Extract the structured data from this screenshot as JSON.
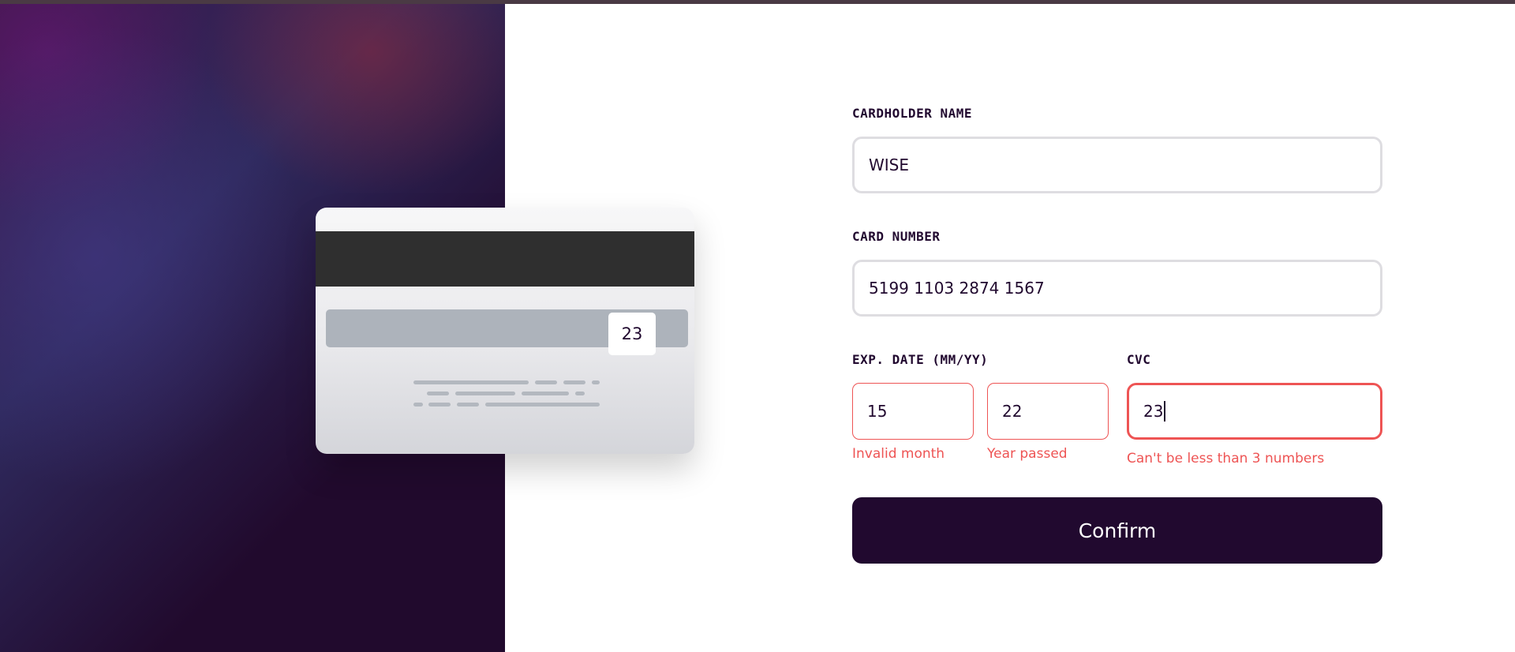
{
  "card_back": {
    "cvc": "23"
  },
  "form": {
    "cardholder_label": "CARDHOLDER NAME",
    "cardholder_value": "WISE",
    "number_label": "CARD NUMBER",
    "number_value": "5199 1103 2874 1567",
    "exp_label": "EXP. DATE (MM/YY)",
    "exp_month_value": "15",
    "exp_year_value": "22",
    "exp_month_error": "Invalid month",
    "exp_year_error": "Year passed",
    "cvc_label": "CVC",
    "cvc_value": "23",
    "cvc_error": "Can't be less than 3 numbers",
    "confirm_label": "Confirm"
  },
  "colors": {
    "brand_dark": "#21092f",
    "error_red": "#ee5454",
    "input_border": "#dedde1"
  },
  "icons": {
    "card_back": "credit-card-back"
  }
}
